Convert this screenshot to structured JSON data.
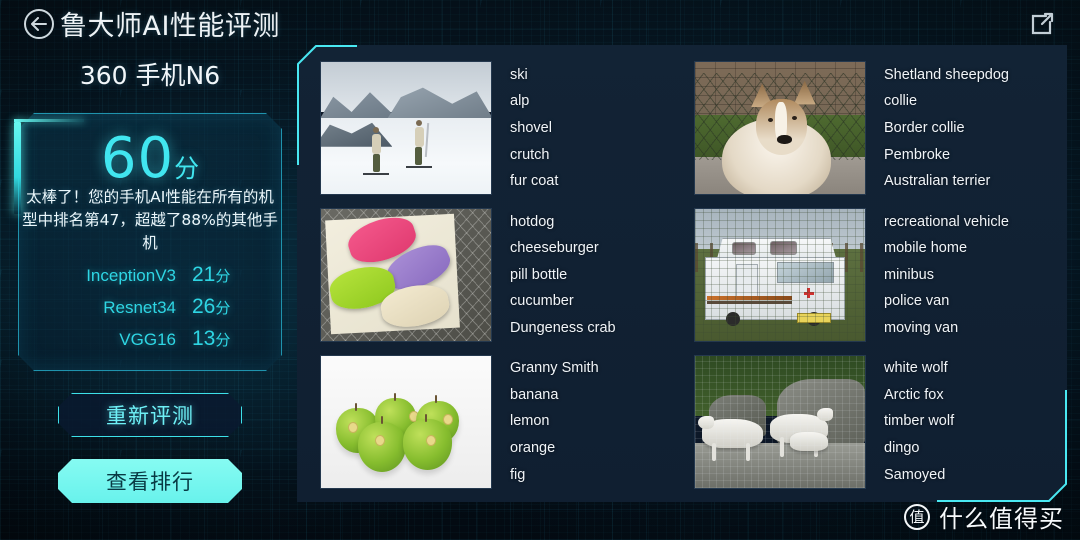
{
  "header": {
    "title": "鲁大师AI性能评测",
    "back_icon": "back-arrow-icon",
    "share_icon": "share-icon"
  },
  "device": {
    "name": "360 手机N6"
  },
  "score_card": {
    "score": "60",
    "score_unit": "分",
    "description": "太棒了！您的手机AI性能在所有的机型中排名第47，超越了88%的其他手机",
    "models": [
      {
        "name": "InceptionV3",
        "score": "21",
        "unit": "分"
      },
      {
        "name": "Resnet34",
        "score": "26",
        "unit": "分"
      },
      {
        "name": "VGG16",
        "score": "13",
        "unit": "分"
      }
    ]
  },
  "actions": {
    "retest_label": "重新评测",
    "ranking_label": "查看排行"
  },
  "results": [
    {
      "image_name": "ski-slope-photo",
      "labels": [
        "ski",
        "alp",
        "shovel",
        "crutch",
        "fur coat"
      ]
    },
    {
      "image_name": "shetland-sheepdog-photo",
      "labels": [
        "Shetland sheepdog",
        "collie",
        "Border collie",
        "Pembroke",
        "Australian terrier"
      ]
    },
    {
      "image_name": "macarons-photo",
      "labels": [
        "hotdog",
        "cheeseburger",
        "pill bottle",
        "cucumber",
        "Dungeness crab"
      ]
    },
    {
      "image_name": "recreational-vehicle-photo",
      "labels": [
        "recreational vehicle",
        "mobile home",
        "minibus",
        "police van",
        "moving van"
      ]
    },
    {
      "image_name": "green-apples-photo",
      "labels": [
        "Granny Smith",
        "banana",
        "lemon",
        "orange",
        "fig"
      ]
    },
    {
      "image_name": "white-wolves-photo",
      "labels": [
        "white wolf",
        "Arctic fox",
        "timber wolf",
        "dingo",
        "Samoyed"
      ]
    }
  ],
  "watermark": {
    "logo_char": "值",
    "text": "什么值得买"
  },
  "colors": {
    "accent_cyan": "#41e6f0",
    "panel_navy": "#122335",
    "background_dark": "#04101a",
    "solid_button": "#6ef2ec"
  }
}
